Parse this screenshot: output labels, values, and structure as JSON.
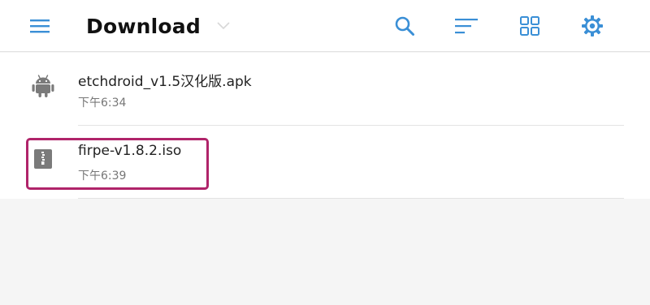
{
  "colors": {
    "accent": "#3a8fd6",
    "highlight": "#b0246a",
    "icon_gray": "#7a7a7a"
  },
  "toolbar": {
    "title": "Download",
    "icons": {
      "menu": "hamburger-menu-icon",
      "dropdown": "chevron-down-icon",
      "search": "search-icon",
      "sort": "sort-icon",
      "view": "grid-view-icon",
      "settings": "gear-icon"
    }
  },
  "files": [
    {
      "name": "etchdroid_v1.5汉化版.apk",
      "time": "下午6:34",
      "icon": "android-icon"
    },
    {
      "name": "firpe-v1.8.2.iso",
      "time": "下午6:39",
      "icon": "archive-zip-icon"
    }
  ]
}
